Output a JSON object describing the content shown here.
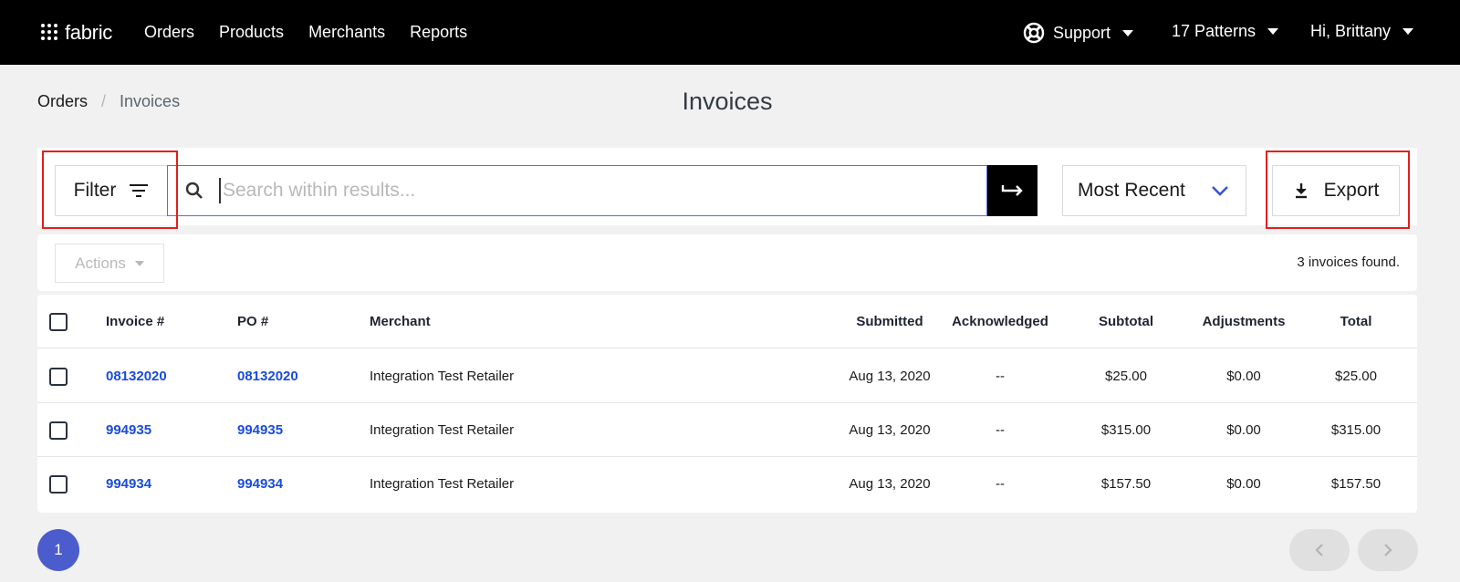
{
  "nav": {
    "brand": "fabric",
    "links": [
      "Orders",
      "Products",
      "Merchants",
      "Reports"
    ],
    "support": "Support",
    "patterns": "17 Patterns",
    "user": "Hi, Brittany"
  },
  "breadcrumb": {
    "root": "Orders",
    "separator": "/",
    "current": "Invoices"
  },
  "page": {
    "title": "Invoices"
  },
  "toolbar": {
    "filter_label": "Filter",
    "search_placeholder": "Search within results...",
    "search_value": "",
    "sort_label": "Most Recent",
    "export_label": "Export"
  },
  "actions": {
    "label": "Actions",
    "found_text": "3 invoices found."
  },
  "table": {
    "headers": {
      "invoice": "Invoice #",
      "po": "PO #",
      "merchant": "Merchant",
      "submitted": "Submitted",
      "acknowledged": "Acknowledged",
      "subtotal": "Subtotal",
      "adjustments": "Adjustments",
      "total": "Total"
    },
    "rows": [
      {
        "invoice": "08132020",
        "po": "08132020",
        "merchant": "Integration Test Retailer",
        "submitted": "Aug 13, 2020",
        "acknowledged": "--",
        "subtotal": "$25.00",
        "adjustments": "$0.00",
        "total": "$25.00"
      },
      {
        "invoice": "994935",
        "po": "994935",
        "merchant": "Integration Test Retailer",
        "submitted": "Aug 13, 2020",
        "acknowledged": "--",
        "subtotal": "$315.00",
        "adjustments": "$0.00",
        "total": "$315.00"
      },
      {
        "invoice": "994934",
        "po": "994934",
        "merchant": "Integration Test Retailer",
        "submitted": "Aug 13, 2020",
        "acknowledged": "--",
        "subtotal": "$157.50",
        "adjustments": "$0.00",
        "total": "$157.50"
      }
    ]
  },
  "pagination": {
    "current": "1"
  },
  "colors": {
    "accent": "#4b5dcc",
    "link": "#1a4be0",
    "highlight": "#e0201c",
    "nav_bg": "#000000"
  },
  "icons": [
    "logo-dots-icon",
    "lifebuoy-icon",
    "filter-lines-icon",
    "search-icon",
    "arrow-right-icon",
    "chevron-down-icon",
    "download-icon",
    "chevron-left-icon",
    "chevron-right-icon"
  ]
}
